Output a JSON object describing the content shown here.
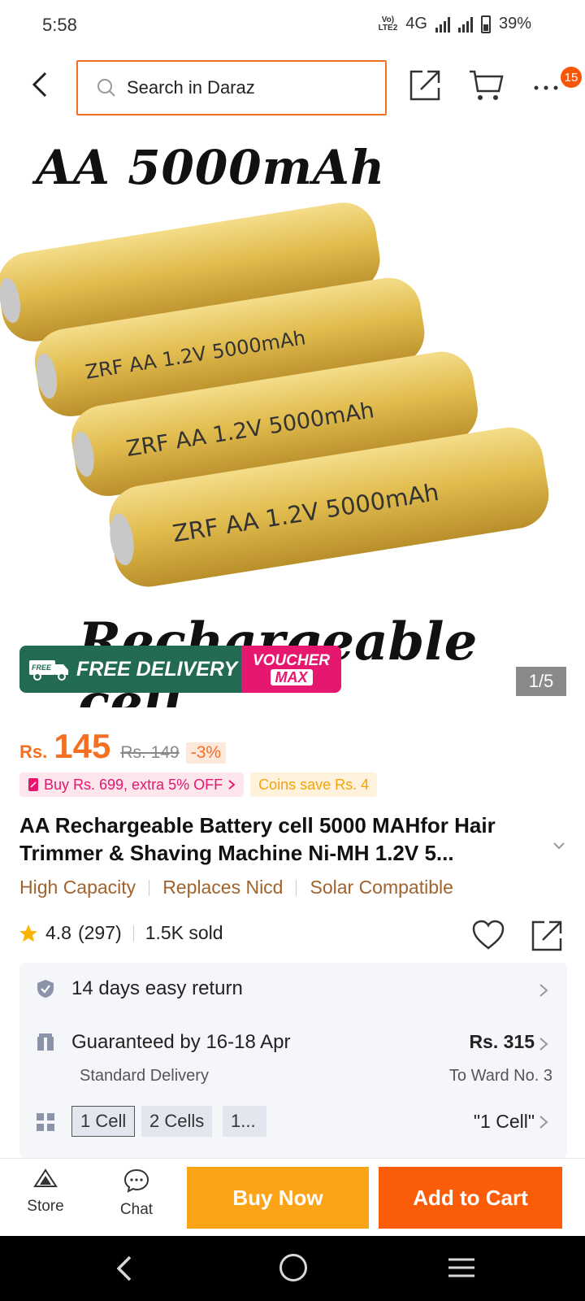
{
  "status_bar": {
    "time": "5:58",
    "network_label": "Vo)) LTE2",
    "network_type": "4G",
    "battery": "39%"
  },
  "header": {
    "search_placeholder": "Search in Daraz",
    "cart_badge": "15",
    "accent_color": "#f36f21"
  },
  "gallery": {
    "image_title": "AA 5000mAh",
    "image_caption": "Rechargeable cell",
    "battery_label": "ZRF AA 1.2V 5000mAh",
    "page_counter": "1/5",
    "promo_free": "FREE DELIVERY",
    "promo_free_tag": "FREE",
    "promo_voucher_top": "VOUCHER",
    "promo_voucher_bottom": "MAX"
  },
  "price": {
    "currency": "Rs.",
    "value": "145",
    "old_price": "Rs. 149",
    "discount": "-3%"
  },
  "promos": {
    "buy_offer": "Buy Rs. 699, extra 5% OFF",
    "coins": "Coins save Rs. 4"
  },
  "product": {
    "title": "AA Rechargeable Battery cell 5000 MAHfor Hair Trimmer & Shaving Machine Ni-MH 1.2V 5...",
    "features": [
      "High Capacity",
      "Replaces Nicd",
      "Solar Compatible"
    ],
    "rating": "4.8",
    "reviews": "(297)",
    "sold": "1.5K sold"
  },
  "info": {
    "return_text": "14 days easy return",
    "delivery_text": "Guaranteed by 16-18 Apr",
    "delivery_sub": "Standard Delivery",
    "delivery_price": "Rs. 315",
    "delivery_location": "To Ward No. 3",
    "variants": [
      "1 Cell",
      "2 Cells",
      "1..."
    ],
    "selected_variant": "\"1 Cell\""
  },
  "action_bar": {
    "store_label": "Store",
    "chat_label": "Chat",
    "buy_now": "Buy Now",
    "add_to_cart": "Add to Cart"
  }
}
